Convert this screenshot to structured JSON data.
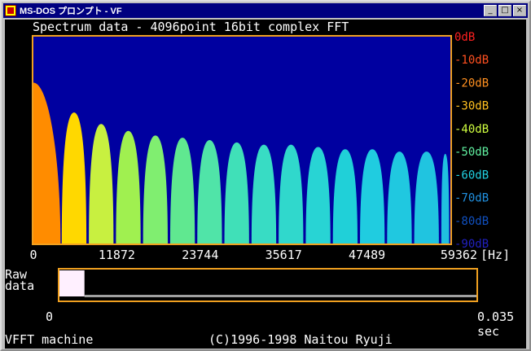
{
  "window": {
    "title": "MS-DOS プロンプト - VF"
  },
  "controls": {
    "minimize": "_",
    "maximize": "□",
    "close": "×"
  },
  "spectrum_title": "Spectrum data - 4096point 16bit complex FFT",
  "raw_label_1": "Raw",
  "raw_label_2": "data",
  "time_start": "0",
  "time_end": "0.035",
  "time_unit": "sec",
  "footer_left": "VFFT machine",
  "footer_right": "(C)1996-1998 Naitou Ryuji",
  "colors": {
    "plot_bg": "#0000a0",
    "frame": "#f0a020",
    "raw_block": "#fff0ff",
    "raw_line": "#a0a0a0"
  },
  "chart_data": {
    "type": "area",
    "x_unit": "[Hz]",
    "x_ticks": [
      "0",
      "11872",
      "23744",
      "35617",
      "47489",
      "59362"
    ],
    "y_ticks": [
      {
        "label": "0dB",
        "color": "#ff2020"
      },
      {
        "label": "-10dB",
        "color": "#ff5020"
      },
      {
        "label": "-20dB",
        "color": "#ff9020"
      },
      {
        "label": "-30dB",
        "color": "#ffc020"
      },
      {
        "label": "-40dB",
        "color": "#d0ff40"
      },
      {
        "label": "-50dB",
        "color": "#60f0a0"
      },
      {
        "label": "-60dB",
        "color": "#20d0e0"
      },
      {
        "label": "-70dB",
        "color": "#2090e0"
      },
      {
        "label": "-80dB",
        "color": "#1050c0"
      },
      {
        "label": "-90dB",
        "color": "#2020c0"
      }
    ],
    "ylim": [
      -90,
      0
    ],
    "xlim": [
      0,
      59362
    ],
    "lobes": [
      {
        "x_start": 0,
        "x_end": 3860,
        "peak_db": -20
      },
      {
        "x_start": 3860,
        "x_end": 7720,
        "peak_db": -33
      },
      {
        "x_start": 7720,
        "x_end": 11580,
        "peak_db": -38
      },
      {
        "x_start": 11580,
        "x_end": 15440,
        "peak_db": -41
      },
      {
        "x_start": 15440,
        "x_end": 19300,
        "peak_db": -43
      },
      {
        "x_start": 19300,
        "x_end": 23160,
        "peak_db": -44
      },
      {
        "x_start": 23160,
        "x_end": 27020,
        "peak_db": -45
      },
      {
        "x_start": 27020,
        "x_end": 30880,
        "peak_db": -46
      },
      {
        "x_start": 30880,
        "x_end": 34740,
        "peak_db": -47
      },
      {
        "x_start": 34740,
        "x_end": 38600,
        "peak_db": -47
      },
      {
        "x_start": 38600,
        "x_end": 42460,
        "peak_db": -48
      },
      {
        "x_start": 42460,
        "x_end": 46320,
        "peak_db": -49
      },
      {
        "x_start": 46320,
        "x_end": 50180,
        "peak_db": -49
      },
      {
        "x_start": 50180,
        "x_end": 54040,
        "peak_db": -50
      },
      {
        "x_start": 54040,
        "x_end": 57900,
        "peak_db": -50
      },
      {
        "x_start": 57900,
        "x_end": 59362,
        "peak_db": -51
      }
    ],
    "floor_db": -90
  },
  "raw_data": {
    "marker_fraction_start": 0,
    "marker_fraction_end": 0.06
  }
}
